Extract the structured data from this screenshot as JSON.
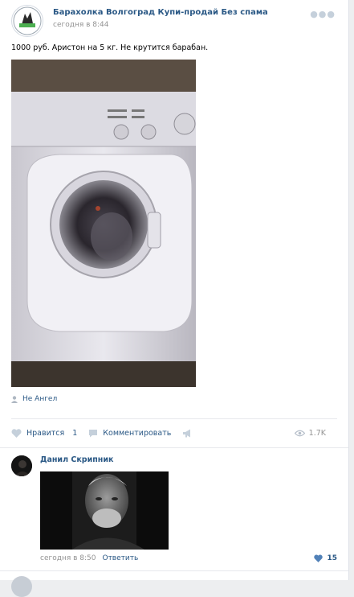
{
  "post": {
    "group_name": "Барахолка Волгоград Купи-продай Без спама",
    "time": "сегодня в 8:44",
    "text": "1000 руб. Аристон на 5 кг. Не крутится барабан.",
    "signer": "Не Ангел"
  },
  "actions": {
    "like_label": "Нравится",
    "like_count": "1",
    "comment_label": "Комментировать",
    "views": "1.7K"
  },
  "comment": {
    "author": "Данил Скрипник",
    "time": "сегодня в 8:50",
    "reply_label": "Ответить",
    "likes": "15"
  },
  "colors": {
    "link": "#2a5885",
    "muted": "#939393",
    "icon": "#c5d0db"
  },
  "icons": [
    "group-avatar",
    "more-icon",
    "user-icon",
    "heart-icon",
    "comment-icon",
    "share-icon",
    "eye-icon"
  ]
}
